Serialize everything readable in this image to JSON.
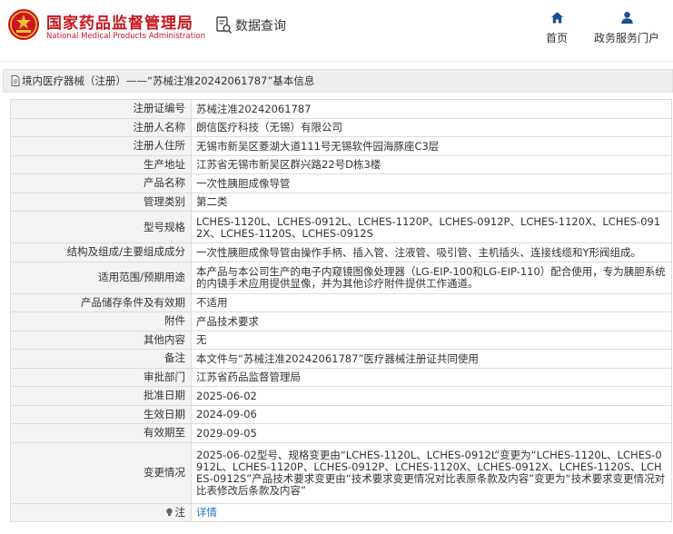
{
  "header": {
    "brand_cn": "国家药品监督管理局",
    "brand_en": "National Medical Products Administration",
    "data_query_label": "数据查询",
    "nav": [
      {
        "label": "首页",
        "icon": "home-icon"
      },
      {
        "label": "政务服务门户",
        "icon": "user-icon"
      }
    ],
    "brand_color": "#c8171e"
  },
  "title_bar": {
    "text": "境内医疗器械（注册）——“苏械注准20242061787”基本信息"
  },
  "rows": [
    {
      "label": "注册证编号",
      "value": "苏械注准20242061787"
    },
    {
      "label": "注册人名称",
      "value": "朗信医疗科技（无锡）有限公司"
    },
    {
      "label": "注册人住所",
      "value": "无锡市新吴区菱湖大道111号无锡软件园海豚座C3层"
    },
    {
      "label": "生产地址",
      "value": "江苏省无锡市新吴区群兴路22号D栋3楼"
    },
    {
      "label": "产品名称",
      "value": "一次性胰胆成像导管"
    },
    {
      "label": "管理类别",
      "value": "第二类"
    },
    {
      "label": "型号规格",
      "value": "LCHES-1120L、LCHES-0912L、LCHES-1120P、LCHES-0912P、LCHES-1120X、LCHES-0912X、LCHES-1120S、LCHES-0912S"
    },
    {
      "label": "结构及组成/主要组成成分",
      "value": "一次性胰胆成像导管由操作手柄、插入管、注液管、吸引管、主机插头、连接线缆和Y形阀组成。"
    },
    {
      "label": "适用范围/预期用途",
      "value": "本产品与本公司生产的电子内窥镜图像处理器（LG-EIP-100和LG-EIP-110）配合使用，专为胰胆系统的内镜手术应用提供显像，并为其他诊疗附件提供工作通道。"
    },
    {
      "label": "产品储存条件及有效期",
      "value": "不适用"
    },
    {
      "label": "附件",
      "value": "产品技术要求"
    },
    {
      "label": "其他内容",
      "value": "无"
    },
    {
      "label": "备注",
      "value": "本文件与“苏械注准20242061787”医疗器械注册证共同使用"
    },
    {
      "label": "审批部门",
      "value": "江苏省药品监督管理局"
    },
    {
      "label": "批准日期",
      "value": "2025-06-02"
    },
    {
      "label": "生效日期",
      "value": "2024-09-06"
    },
    {
      "label": "有效期至",
      "value": "2029-09-05"
    },
    {
      "label": "变更情况",
      "value": "2025-06-02型号、规格变更由“LCHES-1120L、LCHES-0912L”变更为“LCHES-1120L、LCHES-0912L、LCHES-1120P、LCHES-0912P、LCHES-1120X、LCHES-0912X、LCHES-1120S、LCHES-0912S”产品技术要求变更由“技术要求变更情况对比表原条款及内容”变更为“技术要求变更情况对比表修改后条款及内容”"
    },
    {
      "label": "注",
      "value": "详情",
      "icon": "lightbulb-icon"
    }
  ],
  "link_color": "#1e6fc8"
}
